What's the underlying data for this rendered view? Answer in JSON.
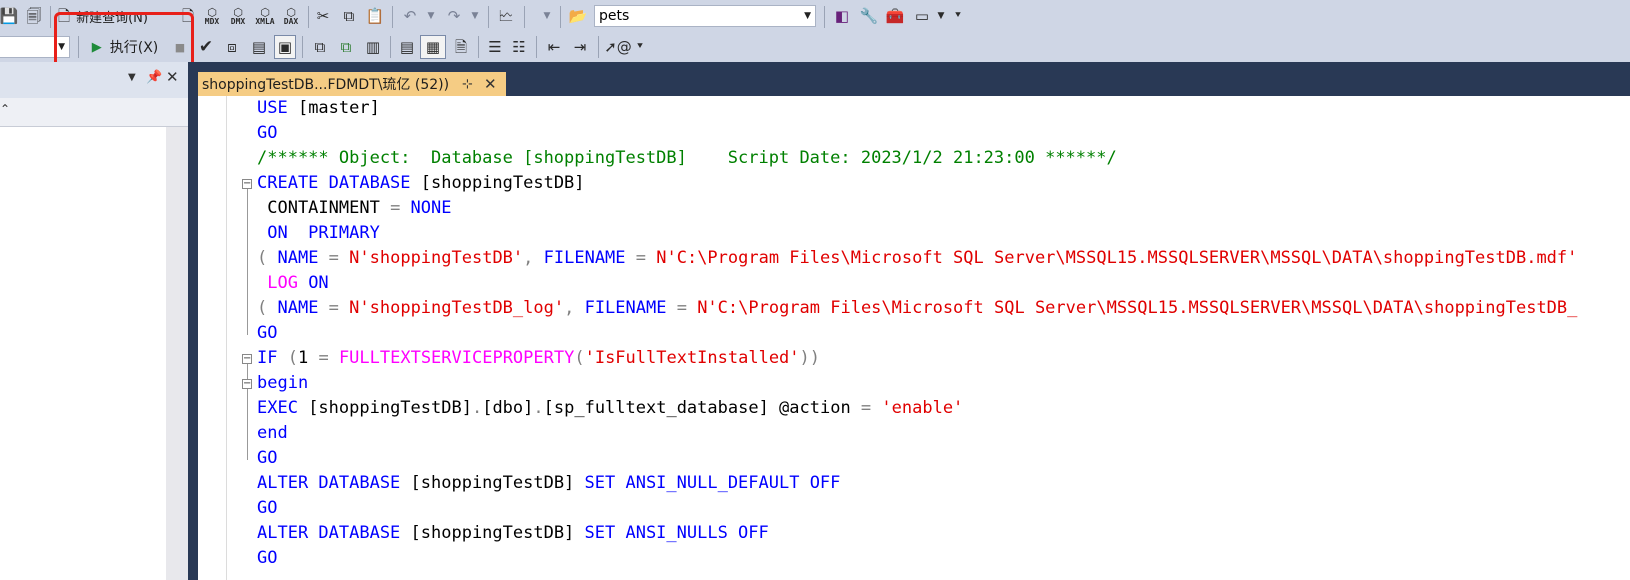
{
  "toolbar1": {
    "new_query_label": "新建查询(N)",
    "mdx_label": "MDX",
    "dmx_label": "DMX",
    "xmla_label": "XMLA",
    "dax_label": "DAX",
    "database_value": "pets"
  },
  "toolbar2": {
    "execute_label": "执行(X)"
  },
  "document_tab": {
    "title": "shoppingTestDB...FDMDT\\琉亿 (52))"
  },
  "highlight_color": "#e8201a",
  "code_lines": [
    [
      [
        "kw",
        "USE "
      ],
      [
        "tx",
        "[master]"
      ]
    ],
    [
      [
        "kw",
        "GO"
      ]
    ],
    [
      [
        "cm",
        "/****** Object:  Database [shoppingTestDB]    Script Date: 2023/1/2 21:23:00 ******/"
      ]
    ],
    [
      [
        "kw",
        "CREATE DATABASE "
      ],
      [
        "tx",
        "[shoppingTestDB]"
      ]
    ],
    [
      [
        "tx",
        " CONTAINMENT "
      ],
      [
        "gy",
        "= "
      ],
      [
        "kw",
        "NONE"
      ]
    ],
    [
      [
        "kw",
        " ON  PRIMARY"
      ]
    ],
    [
      [
        "gy",
        "( "
      ],
      [
        "kw",
        "NAME "
      ],
      [
        "gy",
        "= "
      ],
      [
        "st",
        "N'shoppingTestDB'"
      ],
      [
        "gy",
        ", "
      ],
      [
        "kw",
        "FILENAME "
      ],
      [
        "gy",
        "= "
      ],
      [
        "st",
        "N'C:\\Program Files\\Microsoft SQL Server\\MSSQL15.MSSQLSERVER\\MSSQL\\DATA\\shoppingTestDB.mdf'"
      ]
    ],
    [
      [
        "fn",
        " LOG "
      ],
      [
        "kw",
        "ON"
      ]
    ],
    [
      [
        "gy",
        "( "
      ],
      [
        "kw",
        "NAME "
      ],
      [
        "gy",
        "= "
      ],
      [
        "st",
        "N'shoppingTestDB_log'"
      ],
      [
        "gy",
        ", "
      ],
      [
        "kw",
        "FILENAME "
      ],
      [
        "gy",
        "= "
      ],
      [
        "st",
        "N'C:\\Program Files\\Microsoft SQL Server\\MSSQL15.MSSQLSERVER\\MSSQL\\DATA\\shoppingTestDB_"
      ]
    ],
    [
      [
        "kw",
        "GO"
      ]
    ],
    [
      [
        "kw",
        "IF "
      ],
      [
        "gy",
        "("
      ],
      [
        "tx",
        "1 "
      ],
      [
        "gy",
        "= "
      ],
      [
        "fn",
        "FULLTEXTSERVICEPROPERTY"
      ],
      [
        "gy",
        "("
      ],
      [
        "st",
        "'IsFullTextInstalled'"
      ],
      [
        "gy",
        "))"
      ]
    ],
    [
      [
        "kw",
        "begin"
      ]
    ],
    [
      [
        "kw",
        "EXEC "
      ],
      [
        "tx",
        "[shoppingTestDB]"
      ],
      [
        "gy",
        "."
      ],
      [
        "tx",
        "[dbo]"
      ],
      [
        "gy",
        "."
      ],
      [
        "tx",
        "[sp_fulltext_database] @action "
      ],
      [
        "gy",
        "= "
      ],
      [
        "st",
        "'enable'"
      ]
    ],
    [
      [
        "kw",
        "end"
      ]
    ],
    [
      [
        "kw",
        "GO"
      ]
    ],
    [
      [
        "kw",
        "ALTER DATABASE "
      ],
      [
        "tx",
        "[shoppingTestDB] "
      ],
      [
        "kw",
        "SET ANSI_NULL_DEFAULT OFF"
      ]
    ],
    [
      [
        "kw",
        "GO"
      ]
    ],
    [
      [
        "kw",
        "ALTER DATABASE "
      ],
      [
        "tx",
        "[shoppingTestDB] "
      ],
      [
        "kw",
        "SET ANSI_NULLS OFF"
      ]
    ],
    [
      [
        "kw",
        "GO"
      ]
    ]
  ]
}
